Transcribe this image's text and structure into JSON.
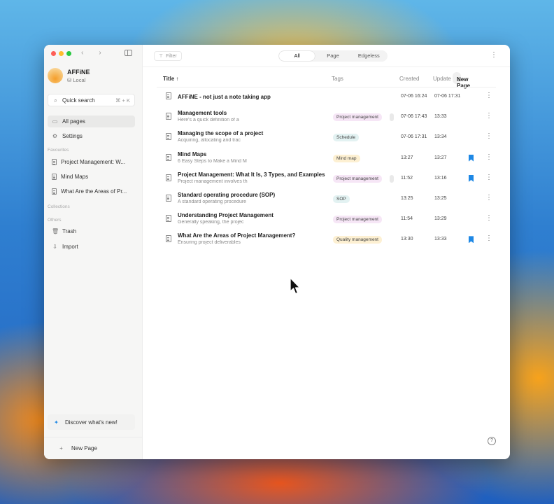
{
  "workspace": {
    "name": "AFFiNE",
    "storage": "Local"
  },
  "sidebar": {
    "search_label": "Quick search",
    "search_shortcut": "⌘ + K",
    "nav": [
      {
        "label": "All pages"
      },
      {
        "label": "Settings"
      }
    ],
    "favourites_title": "Favourites",
    "favourites": [
      {
        "label": "Project Management: W..."
      },
      {
        "label": "Mind Maps"
      },
      {
        "label": "What Are the Areas of Pr..."
      }
    ],
    "collections_title": "Collections",
    "others_title": "Others",
    "others": [
      {
        "label": "Trash"
      },
      {
        "label": "Import"
      }
    ],
    "discover": "Discover what's new!",
    "new_page": "New Page"
  },
  "toolbar": {
    "filter": "Filter",
    "tabs": [
      {
        "label": "All"
      },
      {
        "label": "Page"
      },
      {
        "label": "Edgeless"
      }
    ]
  },
  "table": {
    "columns": {
      "title": "Title",
      "tags": "Tags",
      "created": "Created",
      "updated": "Update"
    },
    "new_page_btn": "New Page",
    "rows": [
      {
        "title": "AFFiNE - not just a note taking app",
        "subtitle": "",
        "tag": "",
        "created": "07-06 16:24",
        "updated": "07-06 17:31",
        "bookmarked": false
      },
      {
        "title": "Management tools",
        "subtitle": "Here's a quick definition of a",
        "tag": "Project management",
        "created": "07-06 17:43",
        "updated": "13:33",
        "bookmarked": false
      },
      {
        "title": "Managing the scope of a project",
        "subtitle": "Acquiring, allocating and trac",
        "tag": "Schedule",
        "created": "07-06 17:31",
        "updated": "13:34",
        "bookmarked": false
      },
      {
        "title": "Mind Maps",
        "subtitle": "6 Easy Steps to Make a Mind M",
        "tag": "Mind map",
        "created": "13:27",
        "updated": "13:27",
        "bookmarked": true
      },
      {
        "title": "Project Management: What It Is, 3 Types, and Examples",
        "subtitle": "Project management involves th",
        "tag": "Project management",
        "created": "11:52",
        "updated": "13:16",
        "bookmarked": true
      },
      {
        "title": "Standard operating procedure (SOP)",
        "subtitle": "A standard operating procedure",
        "tag": "SOP",
        "created": "13:25",
        "updated": "13:25",
        "bookmarked": false
      },
      {
        "title": "Understanding Project Management",
        "subtitle": "Generally speaking, the projec",
        "tag": "Project management",
        "created": "11:54",
        "updated": "13:29",
        "bookmarked": false
      },
      {
        "title": "What Are the Areas of Project Management?",
        "subtitle": "Ensuring project deliverables",
        "tag": "Quality management",
        "created": "13:30",
        "updated": "13:33",
        "bookmarked": true
      }
    ]
  },
  "colors": {
    "tag_project_management": "#f6e6f6",
    "tag_schedule": "#e3f2f2",
    "tag_mind_map": "#fdf0d2",
    "tag_sop": "#e3f2f2",
    "tag_quality_management": "#fdf0d2",
    "bookmark": "#1e88e5"
  }
}
